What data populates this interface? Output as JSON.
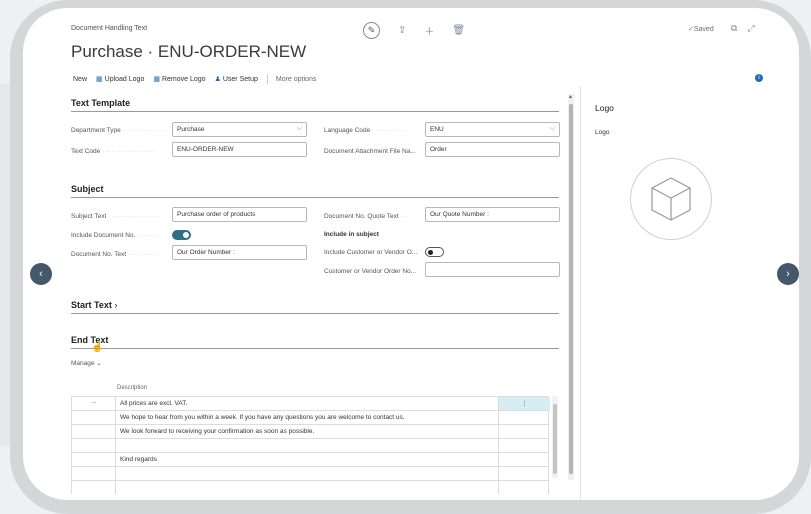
{
  "header": {
    "breadcrumb": "Document Handling Text",
    "title": "Purchase · ENU-ORDER-NEW",
    "status": "Saved"
  },
  "toolbar": {
    "new": "New",
    "upload_logo": "Upload Logo",
    "remove_logo": "Remove Logo",
    "user_setup": "User Setup",
    "more_options": "More options"
  },
  "text_template": {
    "title": "Text Template",
    "department_type_label": "Department Type",
    "department_type_value": "Purchase",
    "text_code_label": "Text Code",
    "text_code_value": "ENU-ORDER-NEW",
    "language_code_label": "Language Code",
    "language_code_value": "ENU",
    "attachment_label": "Document Attachment File Na...",
    "attachment_value": "Order"
  },
  "subject": {
    "title": "Subject",
    "subject_text_label": "Subject Text",
    "subject_text_value": "Purchase order of products",
    "include_doc_no_label": "Include Document No.",
    "include_doc_no": true,
    "doc_no_text_label": "Document No. Text",
    "doc_no_text_value": "Our Order Number :",
    "quote_text_label": "Document No. Quote Text",
    "quote_text_value": "Our Quote Number :",
    "include_in_subject": "Include in subject",
    "include_customer_label": "Include Customer or Vendor O...",
    "include_customer": false,
    "customer_order_label": "Customer or Vendor Order No...",
    "customer_order_value": ""
  },
  "start_text": {
    "title": "Start Text"
  },
  "end_text": {
    "title": "End Text",
    "manage": "Manage",
    "column_header": "Description",
    "rows": [
      "All prices are excl. VAT.",
      "We hope to hear from you within a week. If you have any questions you are welcome to contact us.",
      "We look forward to receiving your confirmation as soon as possible.",
      "",
      "Kind regards",
      "",
      ""
    ]
  },
  "factbox": {
    "title": "Logo",
    "subtitle": "Logo"
  },
  "colors": {
    "accent": "#2f6f84",
    "nav_button": "#44576b",
    "active_cell": "#d6edf3"
  }
}
